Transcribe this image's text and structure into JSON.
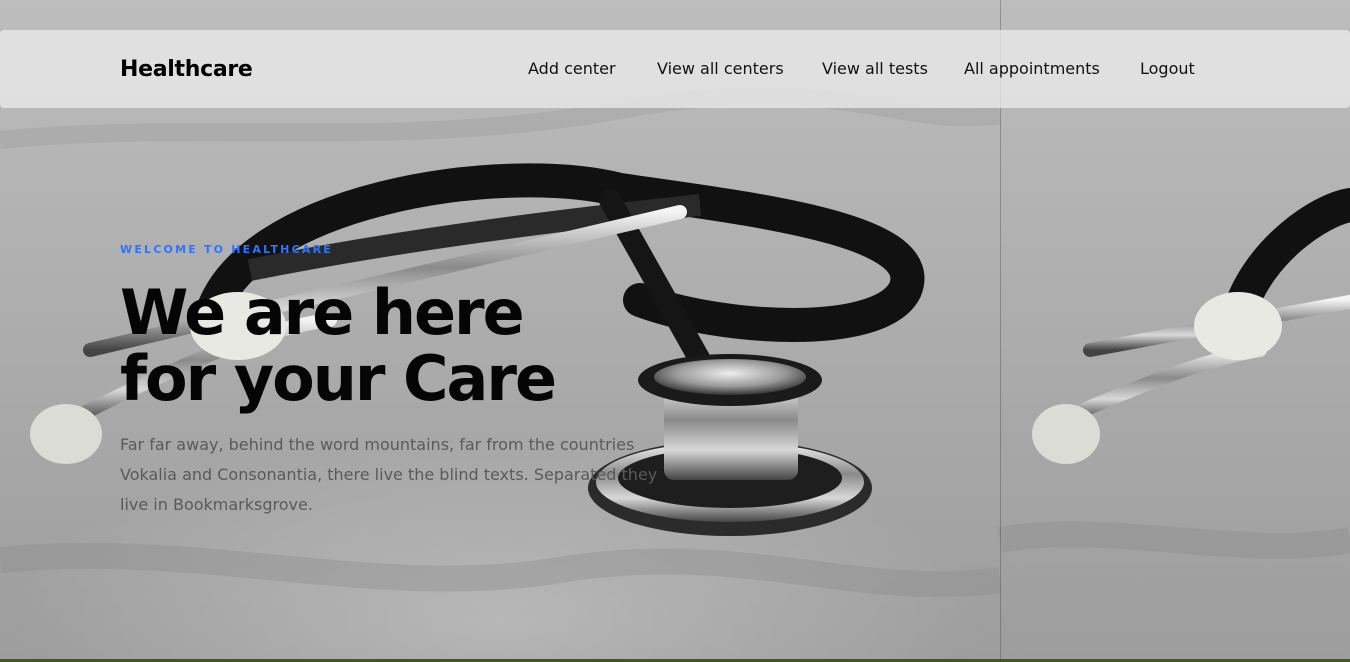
{
  "navbar": {
    "brand": "Healthcare",
    "links": [
      {
        "label": "Add center"
      },
      {
        "label": "View all centers"
      },
      {
        "label": "View all tests"
      },
      {
        "label": "All appointments"
      },
      {
        "label": "Logout"
      }
    ]
  },
  "hero": {
    "eyebrow": "WELCOME TO HEALTHCARE",
    "headline_line1": "We are here",
    "headline_line2": "for your Care",
    "description": "Far far away, behind the word mountains, far from the countries Vokalia and Consonantia, there live the blind texts. Separated they live in Bookmarksgrove.",
    "background_image": "stethoscope-photo"
  },
  "colors": {
    "accent": "#2f74ff",
    "headline": "#050505",
    "nav_bg": "#ebebeb"
  }
}
